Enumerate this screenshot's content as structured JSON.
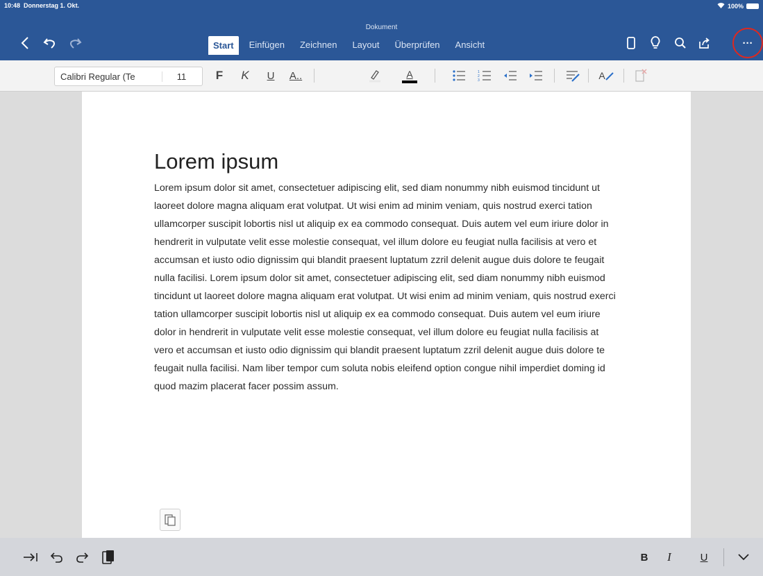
{
  "status_bar": {
    "time": "10:48",
    "date": "Donnerstag 1. Okt.",
    "battery": "100%"
  },
  "title_bar": {
    "document_title": "Dokument",
    "tabs": [
      {
        "label": "Start",
        "active": true
      },
      {
        "label": "Einfügen",
        "active": false
      },
      {
        "label": "Zeichnen",
        "active": false
      },
      {
        "label": "Layout",
        "active": false
      },
      {
        "label": "Überprüfen",
        "active": false
      },
      {
        "label": "Ansicht",
        "active": false
      }
    ],
    "left_icons": [
      "back-icon",
      "undo-icon",
      "redo-icon"
    ],
    "right_icons": [
      "mobile-view-icon",
      "lightbulb-icon",
      "search-icon",
      "share-icon",
      "more-icon"
    ],
    "more_label": "···",
    "highlight_color": "#e0281e",
    "background": "#2b5797"
  },
  "ribbon": {
    "font_name": "Calibri Regular (Te",
    "font_size": "11",
    "bold_label": "F",
    "italic_label": "K",
    "underline_label": "U",
    "font_style_label": "A..",
    "font_color_label": "A",
    "format_label": "A"
  },
  "document": {
    "heading": "Lorem ipsum",
    "body": "Lorem ipsum dolor sit amet, consectetuer adipiscing elit, sed diam nonummy nibh euismod tincidunt ut laoreet dolore magna aliquam erat volutpat. Ut wisi enim ad minim veniam, quis nostrud exerci tation ullamcorper suscipit lobortis nisl ut aliquip ex ea commodo consequat. Duis autem vel eum iriure dolor in hendrerit in vulputate velit esse molestie consequat, vel illum dolore eu feugiat nulla facilisis at vero et accumsan et iusto odio dignissim qui blandit praesent luptatum zzril delenit augue duis dolore te feugait nulla facilisi. Lorem ipsum dolor sit amet, consectetuer adipiscing elit, sed diam nonummy nibh euismod tincidunt ut laoreet dolore magna aliquam erat volutpat. Ut wisi enim ad minim veniam, quis nostrud exerci tation ullamcorper suscipit lobortis nisl ut aliquip ex ea commodo consequat. Duis autem vel eum iriure dolor in hendrerit in vulputate velit esse molestie consequat, vel illum dolore eu feugiat nulla facilisis at vero et accumsan et iusto odio dignissim qui blandit praesent luptatum zzril delenit augue duis dolore te feugait nulla facilisi. Nam liber tempor cum soluta nobis eleifend option congue nihil imperdiet doming id quod mazim placerat facer possim assum."
  },
  "keyboard_bar": {
    "bold_label": "B",
    "italic_label": "I",
    "underline_label": "U",
    "left_icons": [
      "tab-icon",
      "undo-icon",
      "redo-icon",
      "paste-icon"
    ]
  }
}
